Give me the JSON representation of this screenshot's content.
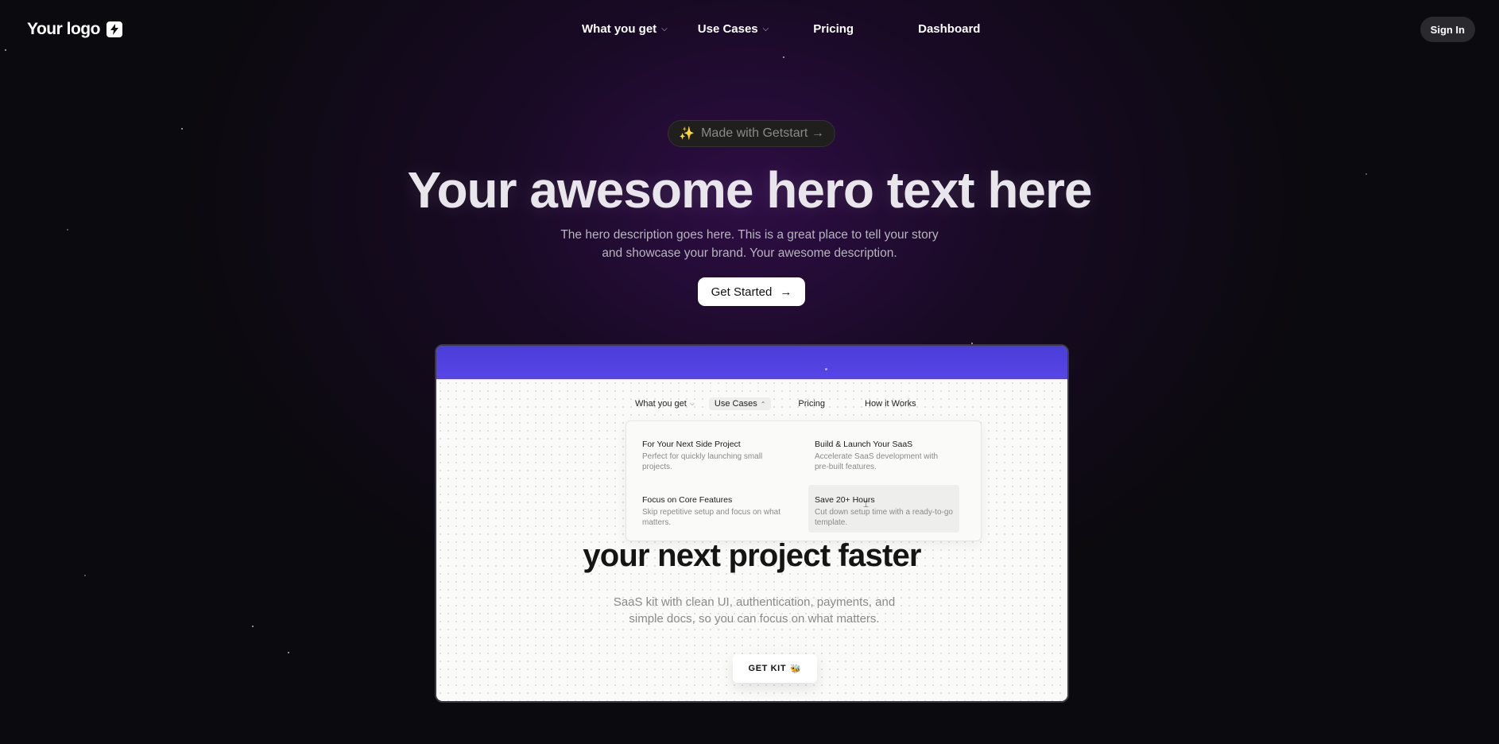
{
  "brand": {
    "logo_text": "Your logo",
    "logo_icon": "bolt-icon"
  },
  "nav": {
    "items": [
      {
        "label": "What you get",
        "dropdown": true
      },
      {
        "label": "Use Cases",
        "dropdown": true
      },
      {
        "label": "Pricing",
        "dropdown": false
      },
      {
        "label": "Dashboard",
        "dropdown": false
      }
    ],
    "signin_label": "Sign In"
  },
  "hero": {
    "badge_icon": "✨",
    "badge_text": "Made with Getstart →",
    "title": "Your awesome hero text here",
    "description": "The hero description goes here. This is a great place to tell your story and showcase your brand. Your awesome description.",
    "cta_label": "Get Started",
    "cta_icon": "→"
  },
  "preview": {
    "nav": {
      "what_you_get": "What you get",
      "use_cases": "Use Cases",
      "pricing": "Pricing",
      "how_it_works": "How it Works"
    },
    "dropdown": [
      {
        "title": "For Your Next Side Project",
        "desc": "Perfect for quickly launching small projects."
      },
      {
        "title": "Build & Launch Your SaaS",
        "desc": "Accelerate SaaS development with pre-built features."
      },
      {
        "title": "Focus on Core Features",
        "desc": "Skip repetitive setup and focus on what matters."
      },
      {
        "title": "Save 20+ Hours",
        "desc": "Cut down setup time with a ready-to-go template."
      }
    ],
    "headline": "your next project faster",
    "description": "SaaS kit with clean UI, authentication, payments, and simple docs, so you can focus on what matters.",
    "button_label": "GET KIT",
    "button_icon": "🐝"
  },
  "colors": {
    "background": "#0b0a0e",
    "glow": "#300e48",
    "preview_bar": "#5142e0"
  }
}
